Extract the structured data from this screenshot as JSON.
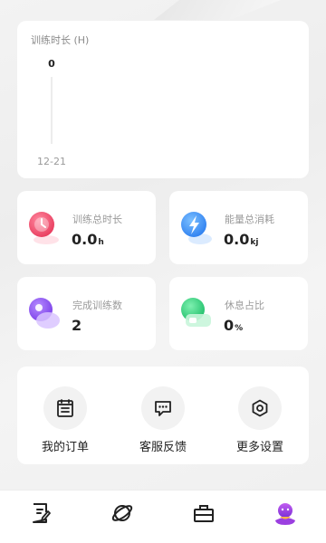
{
  "chart_data": {
    "type": "line",
    "title": "训练时长 (H)",
    "categories": [
      "12-21"
    ],
    "series": [
      {
        "values": [
          0
        ]
      }
    ],
    "data_labels": [
      "0"
    ]
  },
  "stats": [
    {
      "label": "训练总时长",
      "value": "0.0",
      "unit": "h",
      "icon": "clock-icon",
      "color": "#f0506e"
    },
    {
      "label": "能量总消耗",
      "value": "0.0",
      "unit": "kj",
      "icon": "lightning-icon",
      "color": "#3b8cf5"
    },
    {
      "label": "完成训练数",
      "value": "2",
      "unit": "",
      "icon": "workout-count-icon",
      "color": "#8b4ff0"
    },
    {
      "label": "休息占比",
      "value": "0",
      "unit": "%",
      "icon": "rest-ratio-icon",
      "color": "#2fd07a"
    }
  ],
  "menu": [
    {
      "label": "我的订单",
      "icon": "order-list-icon"
    },
    {
      "label": "客服反馈",
      "icon": "chat-feedback-icon"
    },
    {
      "label": "更多设置",
      "icon": "settings-hexagon-icon"
    }
  ],
  "tabs": [
    {
      "icon": "notes-icon",
      "active": false
    },
    {
      "icon": "planet-icon",
      "active": false
    },
    {
      "icon": "shop-bag-icon",
      "active": false
    },
    {
      "icon": "profile-avatar-icon",
      "active": true
    }
  ],
  "colors": {
    "accent": "#8b4ff0",
    "background": "#f2f2f2",
    "card": "#ffffff"
  }
}
